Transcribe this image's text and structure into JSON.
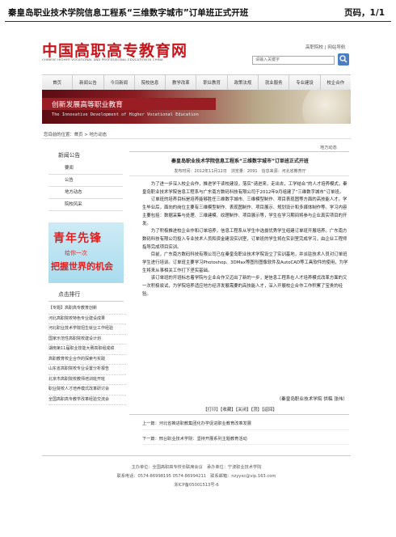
{
  "print_header": {
    "title": "秦皇岛职业技术学院信息工程系“三维数字城市”订单班正式开班",
    "page": "页码，1/1"
  },
  "site": {
    "logo_cn": "中国高职高专教育网",
    "logo_en": "CHINESE HIGHER VOCATIONAL AND PROFESSIONAL EDUCATION IN CHINA",
    "top_links": "高职院校 | 网站导航",
    "search_placeholder": "请输入关键字"
  },
  "nav": [
    "首页",
    "新闻公告",
    "今日新闻",
    "院校信息",
    "教学改革",
    "职业教育",
    "政策法规",
    "就业服务",
    "专业建设",
    "校企合作"
  ],
  "hero": {
    "cn": "创新发展高等职业教育",
    "en": "The Innovative Development of Higher Vocational Education"
  },
  "breadcrumb": "您目前的位置：首页 > 地方动态",
  "sidebar": {
    "title": "新闻公告",
    "items": [
      "要闻",
      "公告",
      "地方动态",
      "院校风采"
    ],
    "promo": {
      "line1": "青年先锋",
      "line2": "给你一次",
      "line3": "把握世界的机会"
    },
    "hot_title": "点击排行",
    "hot_items": [
      "【专题】高职高专教育创新",
      "河北高职院校特色专业建设成果",
      "河北职业技术学院招生就业工作经验",
      "国家示范性高职院校建设计划",
      "湖南第11届职业技能大赛高职组成绩",
      "高职教育校企合作的探索与实践",
      "山东省高职院校专业设置分析报告",
      "北京市高职院校教师培训班开班",
      "职业院校人才培养模式改革研讨会",
      "全国高职高专教学改革经验交流会"
    ]
  },
  "article": {
    "section": "地方动态",
    "title": "秦皇岛职业技术学院信息工程系“三维数字城市”订单班正式开班",
    "meta": "发布时间：2012年11月12日　浏览量：2091　信息来源：河北省教育厅",
    "paragraphs": [
      "为了进一步深入校企合作，推进学干读校建设，落实“请进来，走出去，工学结合”的人才培养模式，秦皇岛职业技术学院信息工程系与广东南方数码科技有限公司于2012年9月组建了“三维数字城市”订单班。",
      "订单班的培养目标是培养能够胜任三维数字城市、三维模型制作、项目表现图等方面的高技能人才。学生毕业后，面向的岗位主要有三维模型制作、表现图制作、项目展示、规划设计和多媒体制作等。学习内容主要包括：数据采集与处理、三维建模、纹理制作、项目展示等，学生在学习期间将参与企业真实项目的开发。",
      "为了积极推进校企合作和订单培养，信息工程系从学生中选拔优秀学生组建订单班开展培养。广东南方数码科技有限公司投入专业技术人员和资金建设实训室，订单班的学生将在实训室完成学习，由企业工程师指导完成项目实训。",
      "目前，广东南方数码科技有限公司已在秦皇岛职业技术学院设立了实训基地，并派驻技术人员对订单班学生进行培训。订单班主要学习Photoshop、3DMax等图形图像软件及AutoCAD等工具软件的使用，为学生将来从事相关工作打下坚实基础。",
      "该订单班的开班标志着学院与企业合作又迈出了新的一步，是信息工程系在人才培养模式改革方面的又一次积极尝试，为学院培养适应地方经济发展需要的高技能人才，深入开展校企合作工作积累了宝贵的经验。"
    ],
    "sign": "（秦皇岛职业技术学院 供稿 张伟）",
    "share": "【打印】【收藏】【关闭】【顶】【返回】",
    "prev": "上一篇：河北省推进职教集团化办学促进职业教育改革发展",
    "next": "下一篇：邢台职业技术学院：坚持开展系列主题教育活动"
  },
  "footer": {
    "l1": "主办单位：全国高职高专校长联席会议　承办单位：宁波职业技术学院",
    "l2": "联系电话：0574-86998195 0574-86994211　联系邮箱：nzyyxc@vip.163.com",
    "l3": "浙ICP备05001513号-6"
  },
  "colors": {
    "brand_red": "#c4161c",
    "nav_bg": "#eeeeee",
    "link_blue": "#4d7fc0"
  }
}
